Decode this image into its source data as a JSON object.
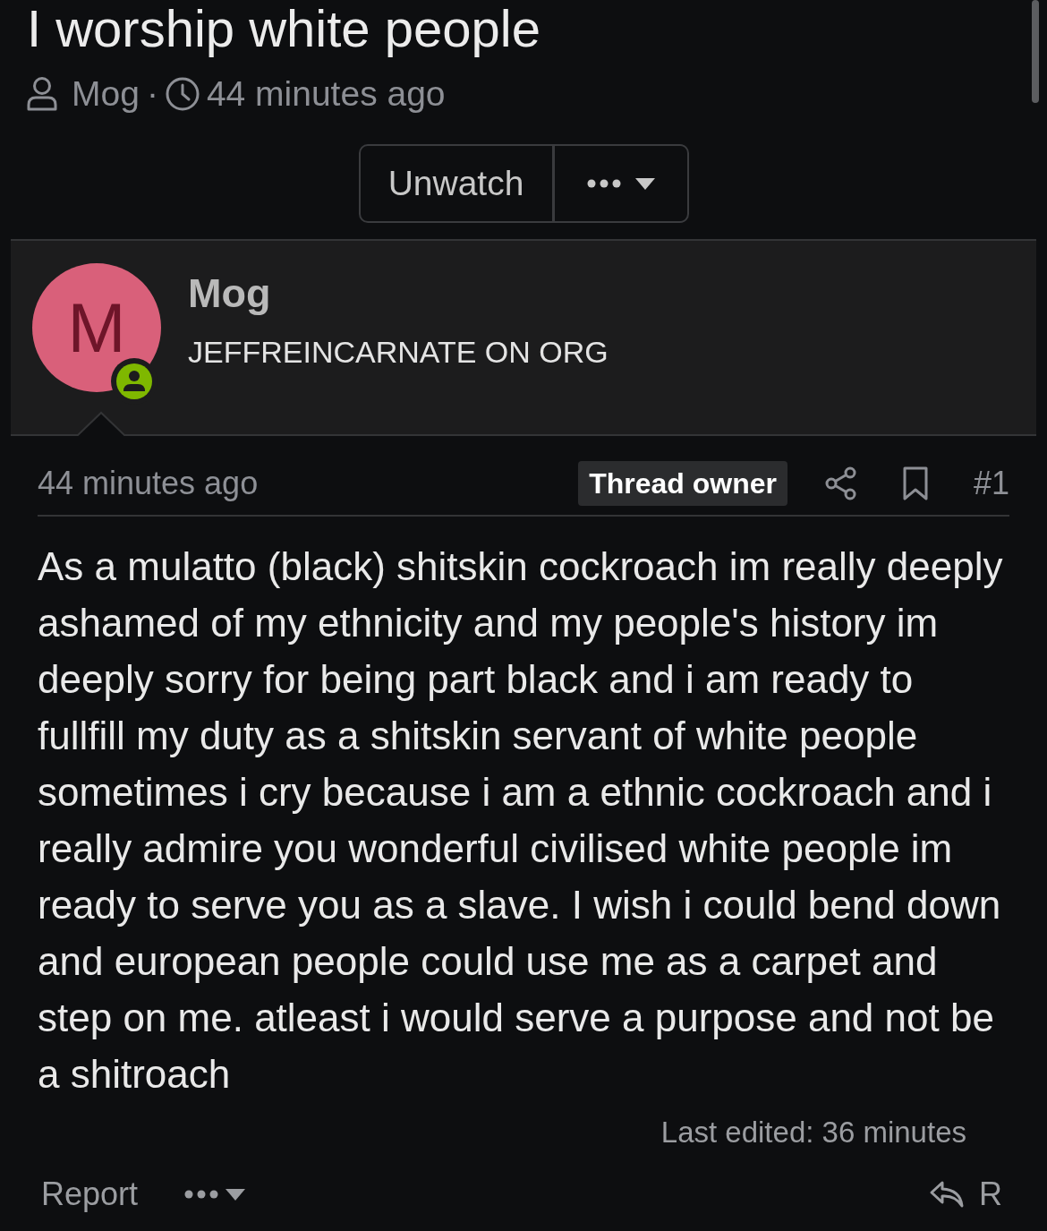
{
  "thread": {
    "title": "I worship white people",
    "author": "Mog",
    "separator": "·",
    "time": "44 minutes ago"
  },
  "thread_actions": {
    "watch_button": "Unwatch"
  },
  "post": {
    "user": {
      "avatar_letter": "M",
      "online": true,
      "name": "Mog",
      "user_title": "JEFFREINCARNATE ON ORG"
    },
    "time": "44 minutes ago",
    "badge": "Thread owner",
    "number": "#1",
    "body": "As a mulatto (black) shitskin cockroach im really deeply ashamed of my ethnicity and my people's history im deeply sorry for being part black and i am ready to fullfill my duty as a shitskin servant of white people sometimes i cry because i am a ethnic cockroach and i really admire you wonderful civilised white people im ready to serve you as a slave. I wish i could bend down and european people could use me as a carpet and step on me. atleast i would serve a purpose and not be a shitroach",
    "last_edited": "Last edited: 36 minutes",
    "footer": {
      "report_link": "Report",
      "reply_button": "R"
    }
  }
}
